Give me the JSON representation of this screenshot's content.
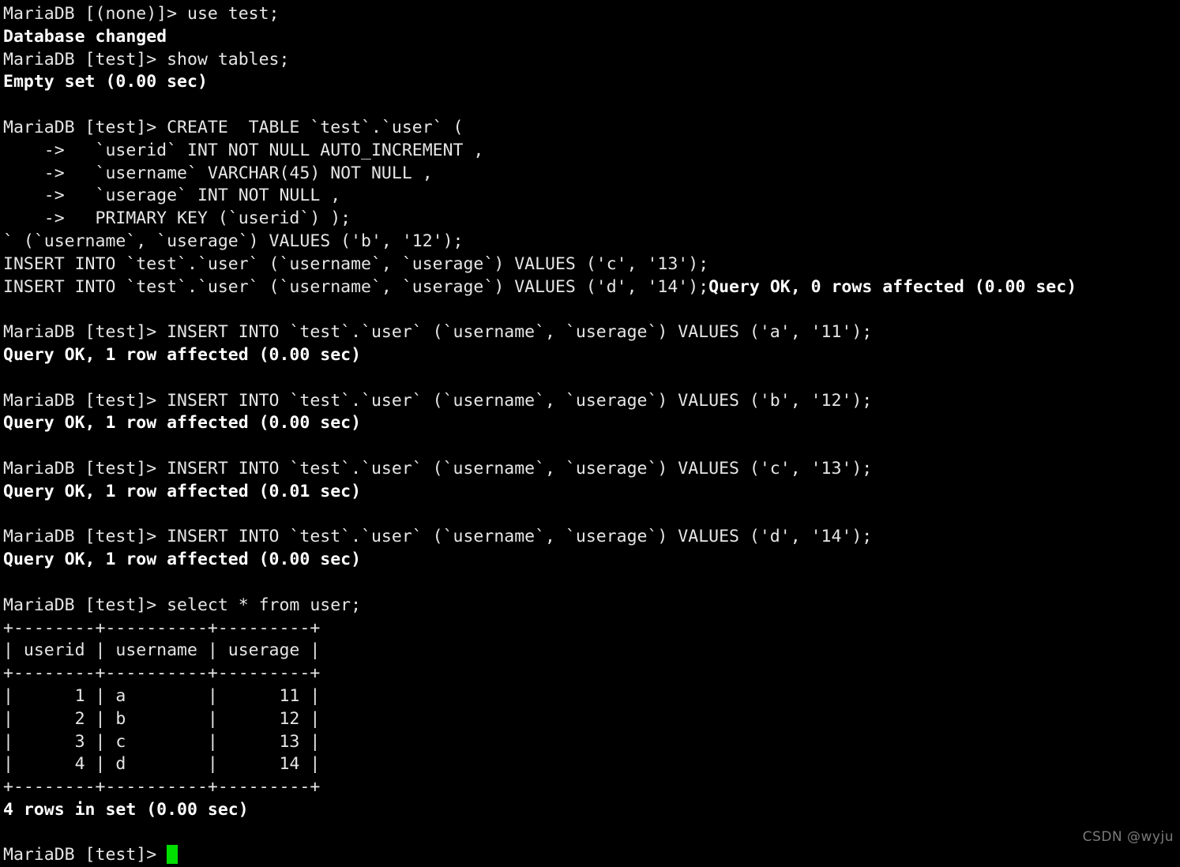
{
  "terminal": {
    "background_color": "#000000",
    "foreground_color": "#e6e6e6",
    "bold_color": "#ffffff",
    "cursor_color": "#00e000",
    "prompt_none": "MariaDB [(none)]> ",
    "prompt_test": "MariaDB [test]> ",
    "continuation_prompt": "    ->   ",
    "lines": [
      {
        "text": "MariaDB [(none)]> use test;",
        "bold": false
      },
      {
        "text": "Database changed",
        "bold": true
      },
      {
        "text": "MariaDB [test]> show tables;",
        "bold": false
      },
      {
        "text": "Empty set (0.00 sec)",
        "bold": true
      },
      {
        "text": "",
        "bold": false
      },
      {
        "text": "MariaDB [test]> CREATE  TABLE `test`.`user` (",
        "bold": false
      },
      {
        "text": "    ->   `userid` INT NOT NULL AUTO_INCREMENT ,",
        "bold": false
      },
      {
        "text": "    ->   `username` VARCHAR(45) NOT NULL ,",
        "bold": false
      },
      {
        "text": "    ->   `userage` INT NOT NULL ,",
        "bold": false
      },
      {
        "text": "    ->   PRIMARY KEY (`userid`) );",
        "bold": false
      },
      {
        "text": "` (`username`, `userage`) VALUES ('b', '12');",
        "bold": false
      },
      {
        "text": "INSERT INTO `test`.`user` (`username`, `userage`) VALUES ('c', '13');",
        "bold": false
      },
      {
        "text": "INSERT INTO `test`.`user` (`username`, `userage`) VALUES ('d', '14');",
        "bold": false,
        "trailing_bold": "Query OK, 0 rows affected (0.00 sec)"
      },
      {
        "text": "",
        "bold": false
      },
      {
        "text": "MariaDB [test]> INSERT INTO `test`.`user` (`username`, `userage`) VALUES ('a', '11');",
        "bold": false
      },
      {
        "text": "Query OK, 1 row affected (0.00 sec)",
        "bold": true
      },
      {
        "text": "",
        "bold": false
      },
      {
        "text": "MariaDB [test]> INSERT INTO `test`.`user` (`username`, `userage`) VALUES ('b', '12');",
        "bold": false
      },
      {
        "text": "Query OK, 1 row affected (0.00 sec)",
        "bold": true
      },
      {
        "text": "",
        "bold": false
      },
      {
        "text": "MariaDB [test]> INSERT INTO `test`.`user` (`username`, `userage`) VALUES ('c', '13');",
        "bold": false
      },
      {
        "text": "Query OK, 1 row affected (0.01 sec)",
        "bold": true
      },
      {
        "text": "",
        "bold": false
      },
      {
        "text": "MariaDB [test]> INSERT INTO `test`.`user` (`username`, `userage`) VALUES ('d', '14');",
        "bold": false
      },
      {
        "text": "Query OK, 1 row affected (0.00 sec)",
        "bold": true
      },
      {
        "text": "",
        "bold": false
      },
      {
        "text": "MariaDB [test]> select * from user;",
        "bold": false
      },
      {
        "text": "+--------+----------+---------+",
        "bold": false
      },
      {
        "text": "| userid | username | userage |",
        "bold": false
      },
      {
        "text": "+--------+----------+---------+",
        "bold": false
      },
      {
        "text": "|      1 | a        |      11 |",
        "bold": false
      },
      {
        "text": "|      2 | b        |      12 |",
        "bold": false
      },
      {
        "text": "|      3 | c        |      13 |",
        "bold": false
      },
      {
        "text": "|      4 | d        |      14 |",
        "bold": false
      },
      {
        "text": "+--------+----------+---------+",
        "bold": false
      },
      {
        "text": "4 rows in set (0.00 sec)",
        "bold": true
      },
      {
        "text": "",
        "bold": false
      },
      {
        "text": "MariaDB [test]> ",
        "bold": false,
        "cursor": true
      }
    ],
    "result_table": {
      "columns": [
        "userid",
        "username",
        "userage"
      ],
      "rows": [
        [
          "1",
          "a",
          "11"
        ],
        [
          "2",
          "b",
          "12"
        ],
        [
          "3",
          "c",
          "13"
        ],
        [
          "4",
          "d",
          "14"
        ]
      ],
      "row_count_text": "4 rows in set (0.00 sec)"
    }
  },
  "watermark": {
    "text": "CSDN @wyju"
  }
}
